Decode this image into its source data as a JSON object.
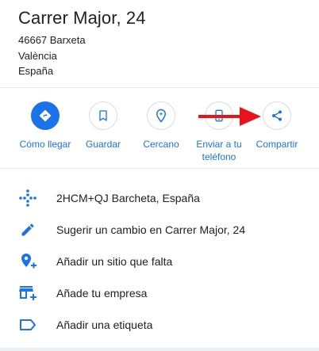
{
  "place": {
    "title": "Carrer Major, 24",
    "address_lines": [
      "46667 Barxeta",
      "València",
      "España"
    ]
  },
  "actions": [
    {
      "label": "Cómo llegar",
      "icon": "directions-icon"
    },
    {
      "label": "Guardar",
      "icon": "bookmark-icon"
    },
    {
      "label": "Cercano",
      "icon": "nearby-icon"
    },
    {
      "label_line1": "Enviar a tu",
      "label_line2": "teléfono",
      "icon": "phone-icon"
    },
    {
      "label": "Compartir",
      "icon": "share-icon"
    }
  ],
  "info_rows": [
    {
      "text": "2HCM+QJ Barcheta, España",
      "icon": "plus-code-icon"
    },
    {
      "text": "Sugerir un cambio en Carrer Major, 24",
      "icon": "edit-icon"
    },
    {
      "text": "Añadir un sitio que falta",
      "icon": "add-place-icon"
    },
    {
      "text": "Añade tu empresa",
      "icon": "add-business-icon"
    },
    {
      "text": "Añadir una etiqueta",
      "icon": "label-icon"
    }
  ],
  "colors": {
    "accent": "#1a73e8",
    "annotation_arrow": "#e8141b",
    "icon_blue": "#1a73e8"
  }
}
